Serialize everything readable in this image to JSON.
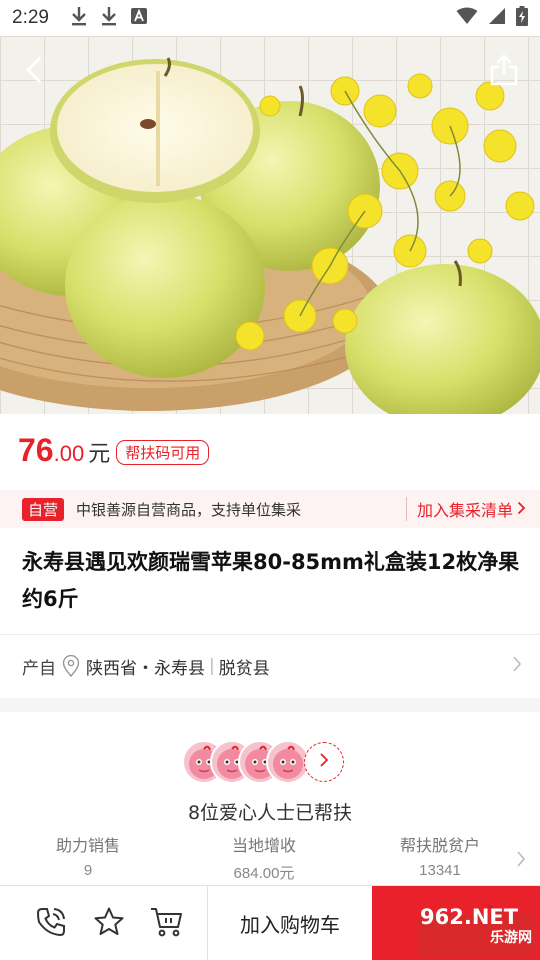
{
  "status_bar": {
    "time": "2:29",
    "notification_icons": [
      "download-icon",
      "download-icon",
      "font-app-icon"
    ],
    "system_icons": [
      "wifi-icon",
      "signal-icon",
      "battery-charging-icon"
    ]
  },
  "hero": {
    "image": "green apples with yellow flowers on woven tray",
    "back_icon": "back-arrow-icon",
    "share_icon": "share-icon"
  },
  "price": {
    "integer": "76",
    "decimal": ".00",
    "unit": "元",
    "coupon_badge": "帮扶码可用",
    "accent_color": "#e8212b"
  },
  "notice": {
    "tag": "自营",
    "text": "中银善源自营商品，支持单位集采",
    "link": "加入集采清单"
  },
  "product": {
    "title": "永寿县遇见欢颜瑞雪苹果80-85mm礼盒装12枚净果约6斤"
  },
  "origin": {
    "label": "产自",
    "location": "陕西省・永寿县",
    "tag": "脱贫县"
  },
  "supporters": {
    "count_text": "8位爱心人士已帮扶",
    "avatar_count": 4,
    "stats": [
      {
        "label": "助力销售",
        "value": "9"
      },
      {
        "label": "当地增收",
        "value": "684.00元"
      },
      {
        "label": "帮扶脱贫户",
        "value": "13341"
      }
    ]
  },
  "bottom_bar": {
    "icons": [
      "customer-service-phone-icon",
      "favorite-star-icon",
      "shopping-cart-icon"
    ],
    "add_to_cart": "加入购物车"
  },
  "watermark": {
    "text_top": "962.NET",
    "text_bottom": "乐游网"
  }
}
